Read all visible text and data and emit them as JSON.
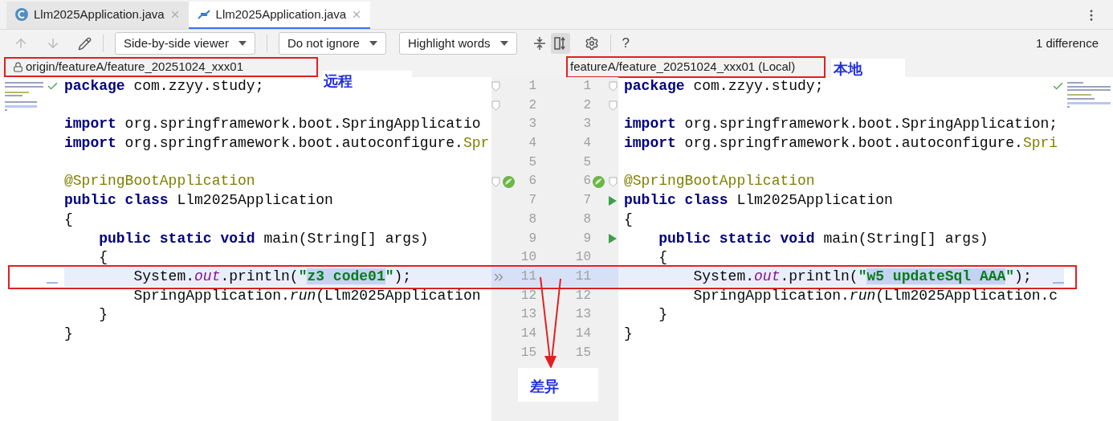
{
  "tabs": [
    {
      "label": "Llm2025Application.java",
      "selected": false
    },
    {
      "label": "Llm2025Application.java",
      "selected": true
    }
  ],
  "toolbar": {
    "viewer": "Side-by-side viewer",
    "ignore": "Do not ignore",
    "highlight": "Highlight words",
    "help": "?",
    "difference_count": "1 difference"
  },
  "left_pane": {
    "title": "origin/featureA/feature_20251024_xxx01",
    "lines": [
      {
        "number": "1",
        "changed": false,
        "markers": [
          {
            "kind": "fold"
          }
        ],
        "tokens": [
          {
            "text": "package",
            "kind": "kw"
          },
          {
            "text": " com.zzyy.study;",
            "kind": "plain"
          }
        ]
      },
      {
        "number": "2",
        "changed": false,
        "markers": [
          {
            "kind": "fold"
          }
        ]
      },
      {
        "number": "3",
        "changed": false,
        "tokens": [
          {
            "text": "import",
            "kind": "kw"
          },
          {
            "text": " org.springframework.boot.SpringApplicatio",
            "kind": "plain"
          }
        ]
      },
      {
        "number": "4",
        "changed": false,
        "tokens": [
          {
            "text": "import",
            "kind": "kw"
          },
          {
            "text": " org.springframework.boot.autoconfigure.",
            "kind": "plain"
          },
          {
            "text": "Spr",
            "kind": "annot"
          }
        ]
      },
      {
        "number": "5",
        "changed": false
      },
      {
        "number": "6",
        "changed": false,
        "markers": [
          {
            "kind": "fold"
          },
          {
            "kind": "bean"
          }
        ],
        "tokens": [
          {
            "text": "@SpringBootApplication",
            "kind": "annot"
          }
        ]
      },
      {
        "number": "7",
        "changed": false,
        "tokens": [
          {
            "text": "public class",
            "kind": "kw"
          },
          {
            "text": " Llm2025Application",
            "kind": "plain"
          }
        ]
      },
      {
        "number": "8",
        "changed": false,
        "tokens": [
          {
            "text": "{",
            "kind": "plain"
          }
        ]
      },
      {
        "number": "9",
        "changed": false,
        "tokens": [
          {
            "text": "    public static void",
            "kind": "kw"
          },
          {
            "text": " main(String[] args)",
            "kind": "plain"
          }
        ]
      },
      {
        "number": "10",
        "changed": false,
        "tokens": [
          {
            "text": "    {",
            "kind": "plain"
          }
        ]
      },
      {
        "number": "11",
        "changed": true,
        "markers": [
          {
            "kind": "apply"
          }
        ],
        "tokens": [
          {
            "text": "        System.",
            "kind": "plain"
          },
          {
            "text": "out",
            "kind": "field"
          },
          {
            "text": ".println(",
            "kind": "plain"
          },
          {
            "text": "\"",
            "kind": "str"
          },
          {
            "text": "z3 code01",
            "kind": "changed_str"
          },
          {
            "text": "\"",
            "kind": "str"
          },
          {
            "text": ");",
            "kind": "plain"
          }
        ]
      },
      {
        "number": "12",
        "changed": false,
        "tokens": [
          {
            "text": "        SpringApplication.",
            "kind": "plain"
          },
          {
            "text": "run",
            "kind": "method"
          },
          {
            "text": "(Llm2025Application",
            "kind": "plain"
          }
        ]
      },
      {
        "number": "13",
        "changed": false,
        "tokens": [
          {
            "text": "    }",
            "kind": "plain"
          }
        ]
      },
      {
        "number": "14",
        "changed": false,
        "tokens": [
          {
            "text": "}",
            "kind": "plain"
          }
        ]
      },
      {
        "number": "15",
        "changed": false
      }
    ]
  },
  "right_pane": {
    "title": "featureA/feature_20251024_xxx01 (Local)",
    "lines": [
      {
        "number": "1",
        "changed": false,
        "markers": [
          {
            "kind": "fold"
          }
        ],
        "tokens": [
          {
            "text": "package",
            "kind": "kw"
          },
          {
            "text": " com.zzyy.study;",
            "kind": "plain"
          }
        ]
      },
      {
        "number": "2",
        "changed": false,
        "markers": [
          {
            "kind": "fold"
          }
        ]
      },
      {
        "number": "3",
        "changed": false,
        "tokens": [
          {
            "text": "import",
            "kind": "kw"
          },
          {
            "text": " org.springframework.boot.SpringApplication;",
            "kind": "plain"
          }
        ]
      },
      {
        "number": "4",
        "changed": false,
        "tokens": [
          {
            "text": "import",
            "kind": "kw"
          },
          {
            "text": " org.springframework.boot.autoconfigure.",
            "kind": "plain"
          },
          {
            "text": "Spri",
            "kind": "annot"
          }
        ]
      },
      {
        "number": "5",
        "changed": false
      },
      {
        "number": "6",
        "changed": false,
        "markers": [
          {
            "kind": "bean"
          },
          {
            "kind": "fold"
          }
        ],
        "tokens": [
          {
            "text": "@SpringBootApplication",
            "kind": "annot"
          }
        ]
      },
      {
        "number": "7",
        "changed": false,
        "markers": [
          {
            "kind": "run"
          }
        ],
        "tokens": [
          {
            "text": "public class",
            "kind": "kw"
          },
          {
            "text": " Llm2025Application",
            "kind": "plain"
          }
        ]
      },
      {
        "number": "8",
        "changed": false,
        "tokens": [
          {
            "text": "{",
            "kind": "plain"
          }
        ]
      },
      {
        "number": "9",
        "changed": false,
        "markers": [
          {
            "kind": "run"
          }
        ],
        "tokens": [
          {
            "text": "    public static void",
            "kind": "kw"
          },
          {
            "text": " main(String[] args)",
            "kind": "plain"
          }
        ]
      },
      {
        "number": "10",
        "changed": false,
        "tokens": [
          {
            "text": "    {",
            "kind": "plain"
          }
        ]
      },
      {
        "number": "11",
        "changed": true,
        "tokens": [
          {
            "text": "        System.",
            "kind": "plain"
          },
          {
            "text": "out",
            "kind": "field"
          },
          {
            "text": ".println(",
            "kind": "plain"
          },
          {
            "text": "\"",
            "kind": "str"
          },
          {
            "text": "w5 updateSql AAA",
            "kind": "changed_str"
          },
          {
            "text": "\"",
            "kind": "str"
          },
          {
            "text": ");",
            "kind": "plain"
          }
        ]
      },
      {
        "number": "12",
        "changed": false,
        "tokens": [
          {
            "text": "        SpringApplication.",
            "kind": "plain"
          },
          {
            "text": "run",
            "kind": "method"
          },
          {
            "text": "(Llm2025Application.c",
            "kind": "plain"
          }
        ]
      },
      {
        "number": "13",
        "changed": false,
        "tokens": [
          {
            "text": "    }",
            "kind": "plain"
          }
        ]
      },
      {
        "number": "14",
        "changed": false,
        "tokens": [
          {
            "text": "}",
            "kind": "plain"
          }
        ]
      },
      {
        "number": "15",
        "changed": false
      }
    ]
  },
  "annotations": [
    {
      "text": "远程"
    },
    {
      "text": "本地"
    },
    {
      "text": "差异"
    }
  ]
}
